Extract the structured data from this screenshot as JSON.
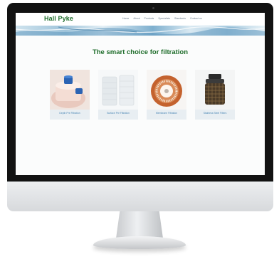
{
  "site": {
    "logo": "Hall Pyke",
    "nav": [
      "Home",
      "About",
      "Products",
      "Specialists",
      "Standards",
      "Contact us"
    ],
    "headline": "The smart choice for filtration",
    "products": [
      {
        "label": "Depth Pre Filtration",
        "icon": "depth-filter-image"
      },
      {
        "label": "Surface Pre Filtration",
        "icon": "surface-filter-image"
      },
      {
        "label": "Membrane Filtration",
        "icon": "membrane-filter-image"
      },
      {
        "label": "Stainless Steel Filters",
        "icon": "steel-filter-image"
      }
    ]
  },
  "colors": {
    "brand_green": "#1f6d2b",
    "link_blue": "#4a86b5",
    "bezel": "#121212"
  }
}
